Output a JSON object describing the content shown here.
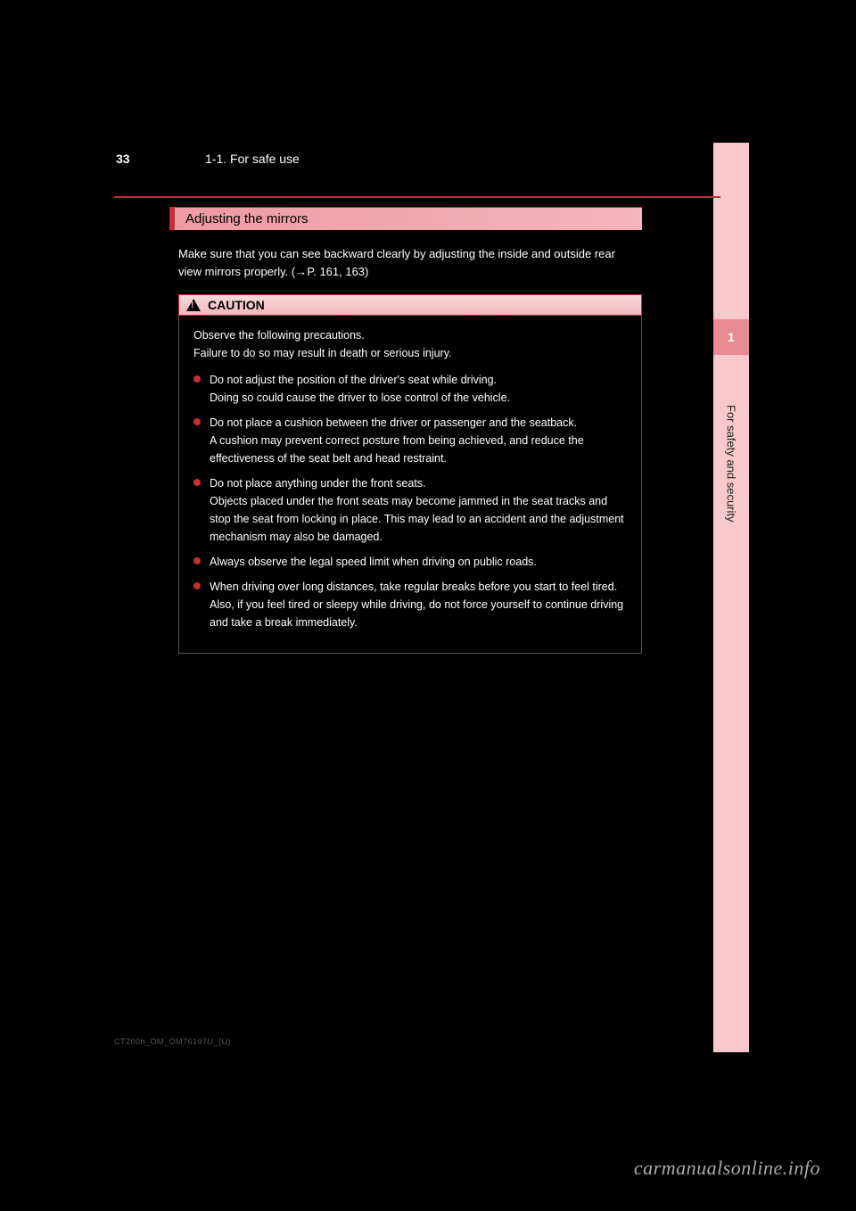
{
  "header": {
    "page_number": "33",
    "breadcrumb": "1-1. For safe use"
  },
  "sidebar": {
    "chapter_number": "1",
    "chapter_label": "For safety and security"
  },
  "section": {
    "title": "Adjusting the mirrors",
    "intro": "Make sure that you can see backward clearly by adjusting the inside and outside rear view mirrors properly. (→P. 161, 163)"
  },
  "caution": {
    "label": "CAUTION",
    "intro": "Observe the following precautions.\nFailure to do so may result in death or serious injury.",
    "bullets": [
      "Do not adjust the position of the driver's seat while driving.\nDoing so could cause the driver to lose control of the vehicle.",
      "Do not place a cushion between the driver or passenger and the seatback.\nA cushion may prevent correct posture from being achieved, and reduce the effectiveness of the seat belt and head restraint.",
      "Do not place anything under the front seats.\nObjects placed under the front seats may become jammed in the seat tracks and stop the seat from locking in place. This may lead to an accident and the adjustment mechanism may also be damaged.",
      "Always observe the legal speed limit when driving on public roads.",
      "When driving over long distances, take regular breaks before you start to feel tired.\nAlso, if you feel tired or sleepy while driving, do not force yourself to continue driving and take a break immediately."
    ]
  },
  "footer": {
    "file_marker": "CT200h_OM_OM76197U_(U)",
    "watermark": "carmanualsonline.info"
  }
}
